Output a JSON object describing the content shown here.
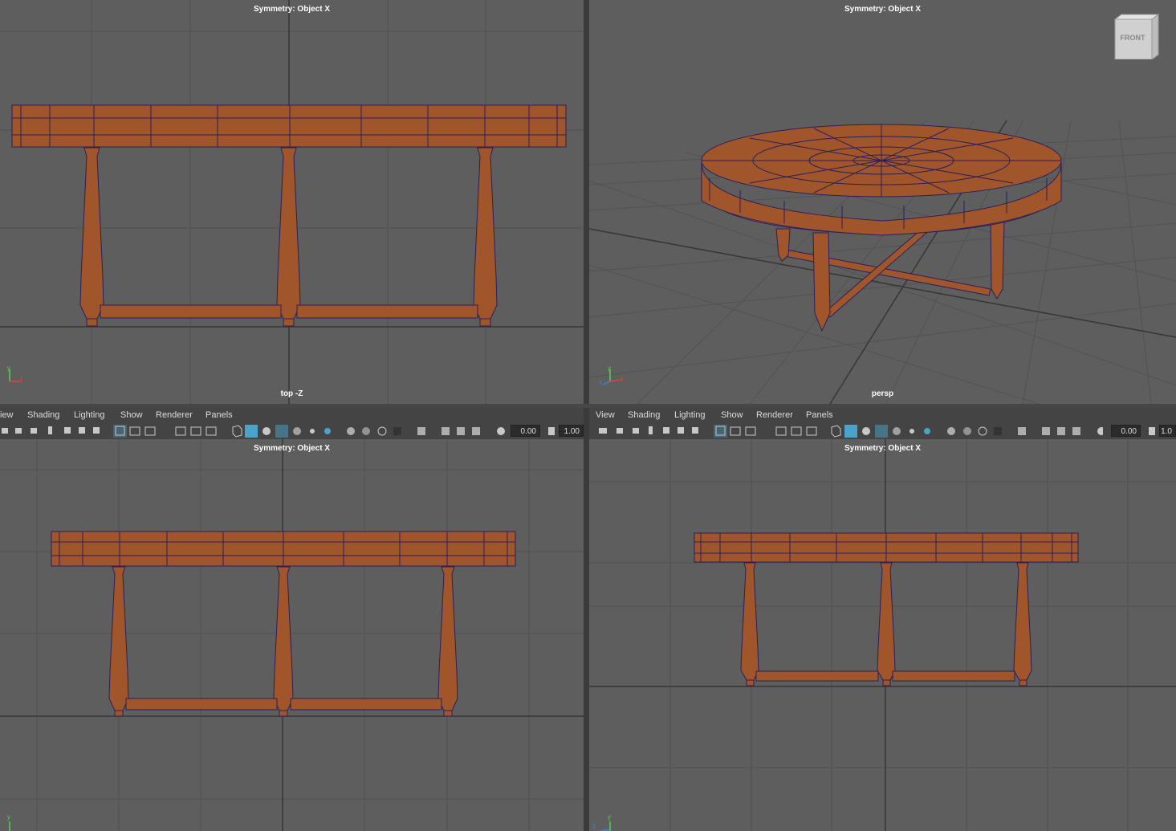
{
  "viewports": {
    "top_left": {
      "symmetry": "Symmetry: Object X",
      "camera": "top -Z"
    },
    "top_right": {
      "symmetry": "Symmetry: Object X",
      "camera": "persp",
      "viewcube": "FRONT"
    },
    "bottom_left": {
      "symmetry": "Symmetry: Object X",
      "camera": ""
    },
    "bottom_right": {
      "symmetry": "Symmetry: Object X",
      "camera": ""
    }
  },
  "panel_menus": {
    "left": [
      "iew",
      "Shading",
      "Lighting",
      "Show",
      "Renderer",
      "Panels"
    ],
    "right": [
      "View",
      "Shading",
      "Lighting",
      "Show",
      "Renderer",
      "Panels"
    ]
  },
  "toolbar": {
    "left": {
      "exposure": "0.00",
      "gamma": "1.00"
    },
    "right": {
      "exposure": "0.00",
      "gamma": "1.0"
    }
  },
  "axis_labels": {
    "y": "y",
    "x": "x",
    "z": "z"
  },
  "colors": {
    "viewport_bg": "#5e5e5e",
    "grid": "#4f4f4f",
    "axis_line": "#353535",
    "mesh_fill": "#a0562a",
    "mesh_edge": "#2a1f5a",
    "selected_icon": "#4aa3c8"
  },
  "icons": [
    "camera-icon",
    "bookmark-icon",
    "grid-icon",
    "wireframe-icon",
    "smooth-shade-icon",
    "texture-icon",
    "light-icon",
    "shadow-icon",
    "xray-icon",
    "isolate-icon",
    "exposure-icon",
    "gamma-icon"
  ]
}
